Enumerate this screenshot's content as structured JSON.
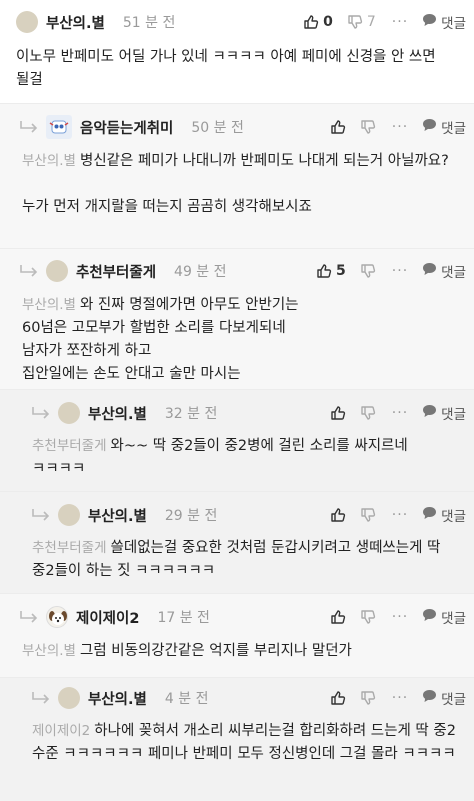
{
  "comments": [
    {
      "nick": "부산의.별",
      "time": "51 분 전",
      "likes": "0",
      "dislikes": "7",
      "reply": "댓글",
      "mention": "",
      "text": "이노무 반페미도 어딜 가나 있네 ㅋㅋㅋㅋ 아예 페미에 신경을 안 쓰면 될걸"
    },
    {
      "nick": "음악듣는게취미",
      "time": "50 분 전",
      "likes": "",
      "dislikes": "",
      "reply": "댓글",
      "mention": "부산의.별",
      "text": "병신같은 페미가 나대니까 반페미도 나대게 되는거 아닐까요?\n\n누가 먼저 개지랄을 떠는지 곰곰히 생각해보시죠"
    },
    {
      "nick": "추천부터줄게",
      "time": "49 분 전",
      "likes": "5",
      "dislikes": "",
      "reply": "댓글",
      "mention": "부산의.별",
      "text": "와 진짜 명절에가면 아무도 안반기는\n60넘은 고모부가 할법한 소리를 다보게되네\n남자가 쪼잔하게 하고\n집안일에는 손도 안대고 술만 마시는"
    },
    {
      "nick": "부산의.별",
      "time": "32 분 전",
      "likes": "",
      "dislikes": "",
      "reply": "댓글",
      "mention": "추천부터줄게",
      "text": "와~~ 딱 중2들이 중2병에 걸린 소리를 싸지르네 ㅋㅋㅋㅋ"
    },
    {
      "nick": "부산의.별",
      "time": "29 분 전",
      "likes": "",
      "dislikes": "",
      "reply": "댓글",
      "mention": "추천부터줄게",
      "text": "쓸데없는걸 중요한 것처럼 둔갑시키려고 생떼쓰는게 딱 중2들이 하는 짓 ㅋㅋㅋㅋㅋㅋ"
    },
    {
      "nick": "제이제이2",
      "time": "17 분 전",
      "likes": "",
      "dislikes": "",
      "reply": "댓글",
      "mention": "부산의.별",
      "text": "그럼 비동의강간같은 억지를 부리지나 말던가"
    },
    {
      "nick": "부산의.별",
      "time": "4 분 전",
      "likes": "",
      "dislikes": "",
      "reply": "댓글",
      "mention": "제이제이2",
      "text": "하나에 꽂혀서 개소리 씨부리는걸 합리화하려 드는게 딱 중2 수준 ㅋㅋㅋㅋㅋㅋ 페미나 반페미 모두 정신병인데 그걸 몰라 ㅋㅋㅋㅋ"
    }
  ],
  "more_label": "···"
}
